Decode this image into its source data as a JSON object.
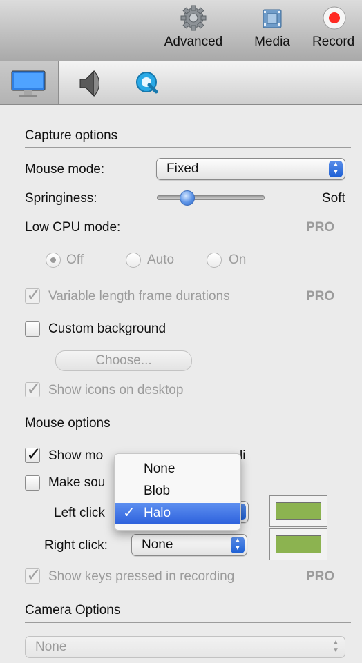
{
  "toolbar": {
    "advanced_label": "Advanced",
    "media_label": "Media",
    "record_label": "Record",
    "record_color": "#ff2a22"
  },
  "tabs": [
    {
      "icon": "display-icon",
      "active": true
    },
    {
      "icon": "speaker-icon",
      "active": false
    },
    {
      "icon": "quicktime-icon",
      "active": false
    }
  ],
  "capture": {
    "section_title": "Capture options",
    "mouse_mode_label": "Mouse mode:",
    "mouse_mode_value": "Fixed",
    "springiness_label": "Springiness:",
    "springiness_max_label": "Soft",
    "springiness_level": 0.28,
    "low_cpu_label": "Low CPU mode:",
    "low_cpu_pro": "PRO",
    "radio_off": "Off",
    "radio_auto": "Auto",
    "radio_on": "On",
    "variable_frame_label": "Variable length frame durations",
    "variable_frame_pro": "PRO",
    "custom_bg_label": "Custom background",
    "choose_button": "Choose...",
    "show_icons_label": "Show icons on desktop"
  },
  "mouse": {
    "section_title": "Mouse options",
    "show_mouse_label": "Show mo",
    "show_mouse_tail": "li",
    "make_sound_label": "Make sou",
    "left_click_label": "Left click",
    "right_click_label": "Right click:",
    "right_click_value": "None",
    "highlight_color": "#8cb350",
    "show_keys_label": "Show keys pressed in recording",
    "show_keys_pro": "PRO"
  },
  "dropdown": {
    "items": [
      "None",
      "Blob",
      "Halo"
    ],
    "selected": "Halo",
    "checkmark": "✓"
  },
  "camera": {
    "section_title": "Camera Options",
    "camera_value": "None"
  }
}
